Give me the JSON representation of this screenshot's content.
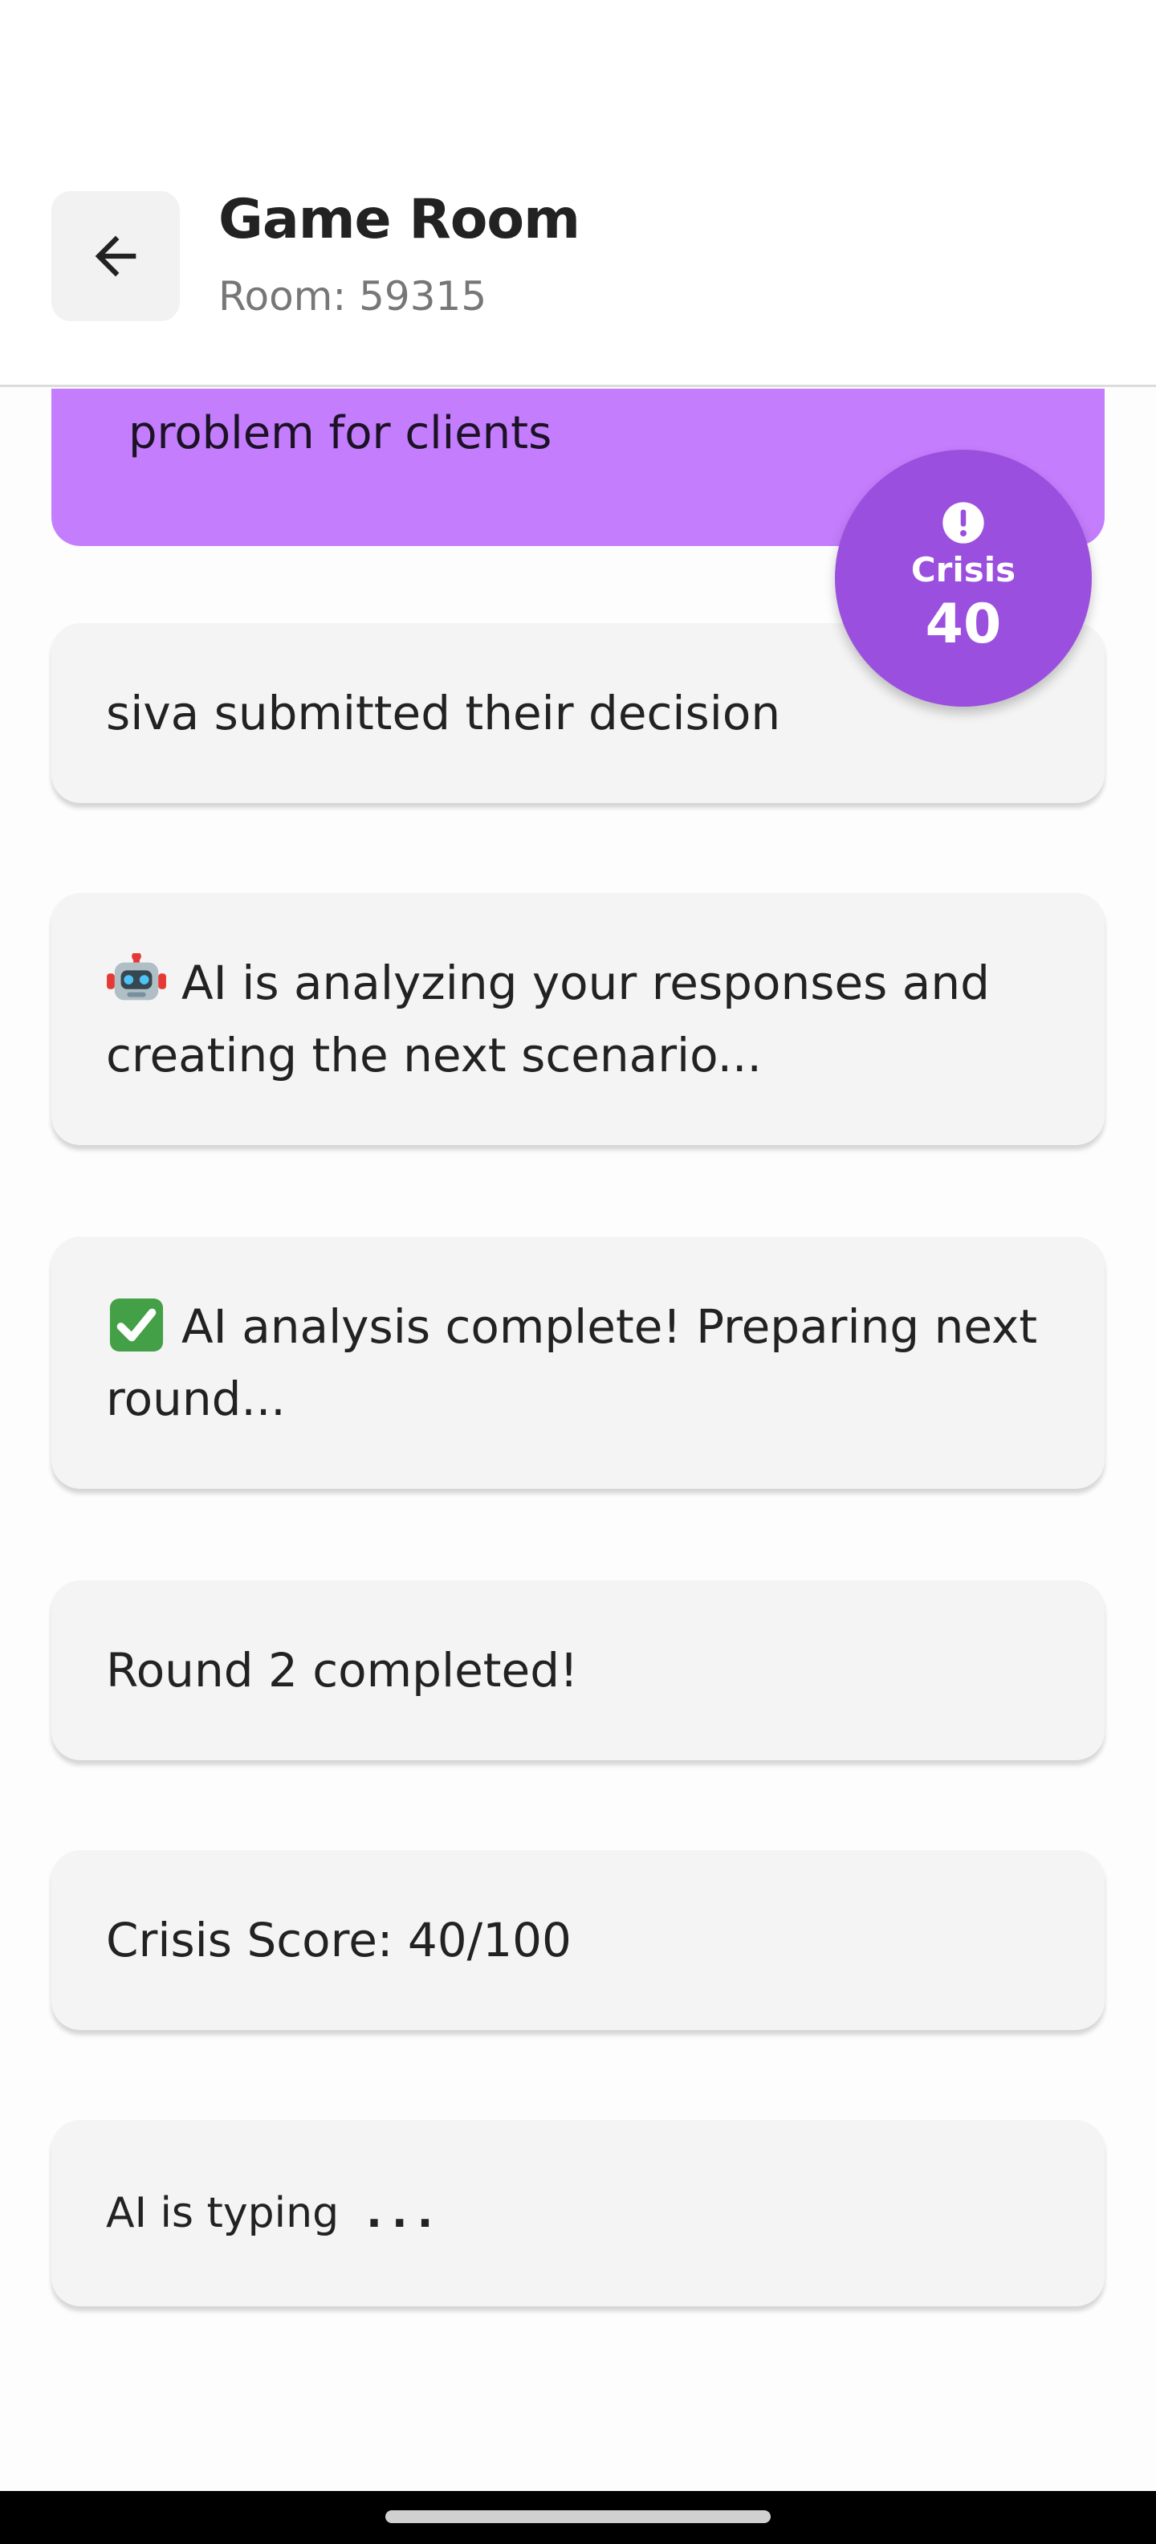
{
  "header": {
    "title": "Game Room",
    "subtitle": "Room: 59315"
  },
  "scenario": {
    "text_visible": "problem for clients"
  },
  "crisis_badge": {
    "label": "Crisis",
    "value": "40",
    "color": "#9b4fde"
  },
  "messages": [
    {
      "text": "siva submitted their decision"
    },
    {
      "icon": "robot-icon",
      "text": "AI is analyzing your responses and creating the next scenario..."
    },
    {
      "icon": "check-mark-icon",
      "text": "AI analysis complete! Preparing next round..."
    },
    {
      "text": "Round 2 completed!"
    },
    {
      "text": "Crisis Score: 40/100"
    }
  ],
  "typing": {
    "text": "AI is typing",
    "dots": "..."
  },
  "colors": {
    "accent_purple": "#c47dfc",
    "badge_purple": "#9b4fde",
    "card_bg": "#f4f4f4"
  }
}
